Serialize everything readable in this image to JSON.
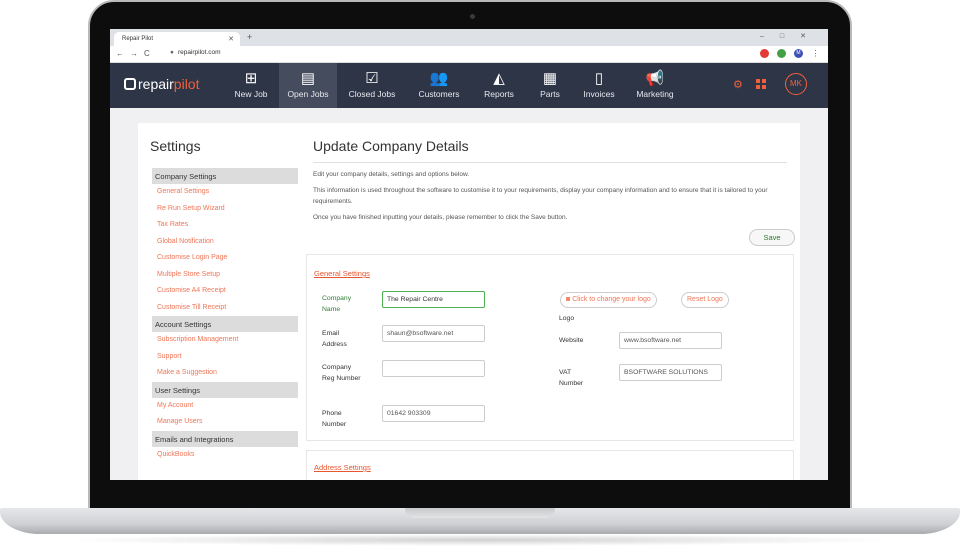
{
  "browser": {
    "tab_title": "Repair Pilot",
    "url": "repairpilot.com",
    "new_tab": "+",
    "window_controls": "–□✕",
    "nav_buttons": "←→C"
  },
  "app": {
    "logo_repair": "repair",
    "logo_pilot": "pilot",
    "nav": [
      {
        "label": "New Job",
        "icon": "plus-square-icon"
      },
      {
        "label": "Open Jobs",
        "icon": "clipboard-icon"
      },
      {
        "label": "Closed Jobs",
        "icon": "clipboard-check-icon"
      },
      {
        "label": "Customers",
        "icon": "users-icon"
      },
      {
        "label": "Reports",
        "icon": "area-chart-icon"
      },
      {
        "label": "Parts",
        "icon": "boxes-icon"
      },
      {
        "label": "Invoices",
        "icon": "file-icon"
      },
      {
        "label": "Marketing",
        "icon": "megaphone-icon"
      }
    ],
    "avatar_initials": "MK",
    "accent": "#f0603a",
    "nav_bg": "#2e3547"
  },
  "sidebar": {
    "title": "Settings",
    "groups": [
      {
        "heading": "Company Settings",
        "links": [
          "General Settings",
          "Re Run Setup Wizard",
          "Tax Rates",
          "Global Notification",
          "Customise Login Page",
          "Multiple Store Setup",
          "Customise A4 Receipt",
          "Customise Till Receipt"
        ]
      },
      {
        "heading": "Account Settings",
        "links": [
          "Subscription Management",
          "Support",
          "Make a Suggestion"
        ]
      },
      {
        "heading": "User Settings",
        "links": [
          "My Account",
          "Manage Users"
        ]
      },
      {
        "heading": "Emails and Integrations",
        "links": [
          "QuickBooks"
        ]
      }
    ]
  },
  "main": {
    "title": "Update Company Details",
    "intro_1": "Edit your company details, settings and options below.",
    "intro_2": "This information is used throughout the software to customise it to your requirements, display your company information and to ensure that it is tailored to your requirements.",
    "intro_3": "Once you have finished inputting your details, please remember to click the Save button.",
    "save_label": "Save",
    "general_settings_link": "General Settings",
    "address_settings_link": "Address Settings",
    "fields": {
      "company_name_label": "Company Name",
      "company_name_value": "The Repair Centre",
      "email_label": "Email Address",
      "email_value": "shaun@bsoftware.net",
      "reg_label": "Company Reg Number",
      "reg_value": "",
      "phone_label": "Phone Number",
      "phone_value": "01642 903309",
      "logo_label": "Logo",
      "change_logo_label": "Click to change your logo",
      "reset_logo_label": "Reset Logo",
      "website_label": "Website",
      "website_value": "www.bsoftware.net",
      "vat_label": "VAT Number",
      "vat_value": "BSOFTWARE SOLUTIONS"
    }
  }
}
